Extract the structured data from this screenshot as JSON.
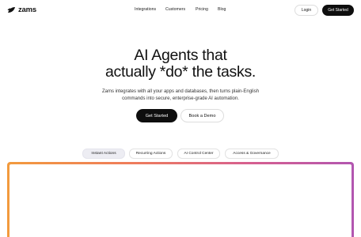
{
  "header": {
    "logo_text": "zams",
    "nav": [
      "Integrations",
      "Customers",
      "Pricing",
      "Blog"
    ],
    "login_label": "Login",
    "get_started_label": "Get Started"
  },
  "hero": {
    "title_line1": "AI Agents that",
    "title_line2": "actually *do* the tasks.",
    "subtitle_line1": "Zams integrates with all your apps and databases, then turns plain-English",
    "subtitle_line2": "commands into secure, enterprise-grade AI automation.",
    "primary_cta": "Get Started",
    "secondary_cta": "Book a Demo"
  },
  "tabs": [
    {
      "label": "Instant Actions",
      "active": true
    },
    {
      "label": "Recurring Actions",
      "active": false
    },
    {
      "label": "AI Control Center",
      "active": false
    },
    {
      "label": "Access & Governance",
      "active": false
    }
  ],
  "colors": {
    "primary": "#0e0e0e",
    "frame_gradient": [
      "#f29a3d",
      "#ef7d5a",
      "#d65f8f",
      "#b256b0"
    ],
    "active_tab_bg": "#ededf3"
  },
  "icons": {
    "logo": "zams-leaf-icon"
  }
}
